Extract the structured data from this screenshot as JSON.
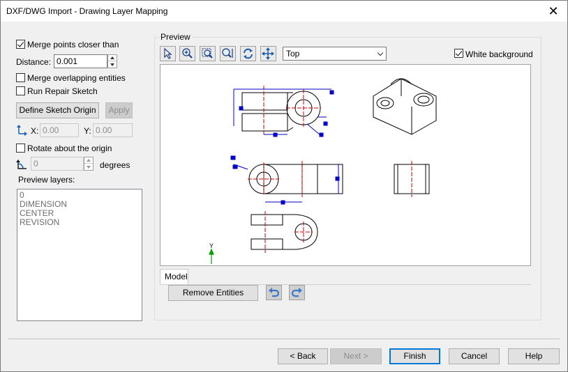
{
  "window": {
    "title": "DXF/DWG Import - Drawing Layer Mapping"
  },
  "options": {
    "merge_points_label": "Merge points closer than",
    "merge_points_checked": true,
    "distance_label": "Distance:",
    "distance_value": "0.001",
    "merge_overlapping_label": "Merge overlapping entities",
    "run_repair_label": "Run Repair Sketch",
    "define_origin_label": "Define Sketch Origin",
    "apply_label": "Apply",
    "x_label": "X:",
    "x_value": "0.00",
    "y_label": "Y:",
    "y_value": "0.00",
    "rotate_label": "Rotate about the origin",
    "angle_value": "0",
    "degrees_label": "degrees",
    "preview_layers_label": "Preview layers:",
    "layers": [
      "0",
      "DIMENSION",
      "CENTER",
      "REVISION"
    ]
  },
  "preview": {
    "group_label": "Preview",
    "view_value": "Top",
    "white_background_label": "White background",
    "white_background_checked": true,
    "tab_model": "Model",
    "remove_entities_label": "Remove Entities",
    "axis_label": "Y",
    "colors": {
      "geometry": "#000000",
      "dimension": "#0000c8",
      "center": "#c80000",
      "axis": "#00a000"
    }
  },
  "footer": {
    "back_label": "< Back",
    "next_label": "Next >",
    "finish_label": "Finish",
    "cancel_label": "Cancel",
    "help_label": "Help"
  }
}
